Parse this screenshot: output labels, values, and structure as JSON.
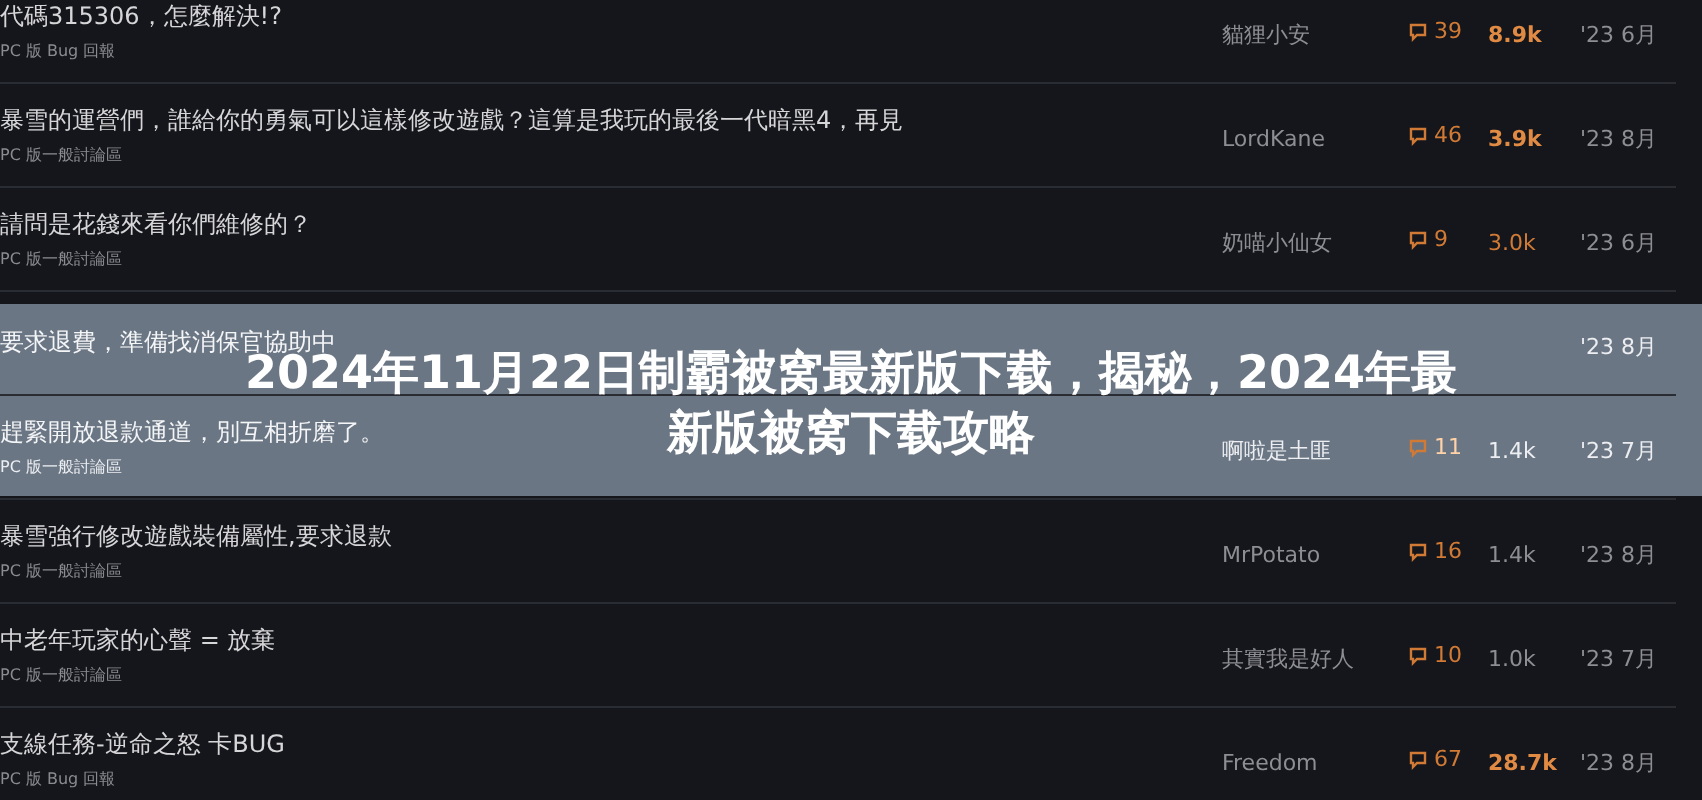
{
  "topics": [
    {
      "title": "代碼315306，怎麼解決!?",
      "forum": "PC 版 Bug 回報",
      "author": "貓狸小安",
      "replies": "39",
      "views": "8.9k",
      "highlighted": true,
      "bold": true,
      "date": "'23 6月"
    },
    {
      "title": "暴雪的運營們，誰給你的勇氣可以這樣修改遊戲？這算是我玩的最後一代暗黑4，再見",
      "forum": "PC 版一般討論區",
      "author": "LordKane",
      "replies": "46",
      "views": "3.9k",
      "highlighted": true,
      "bold": true,
      "date": "'23 8月"
    },
    {
      "title": "請問是花錢來看你們維修的？",
      "forum": "PC 版一般討論區",
      "author": "奶喵小仙女",
      "replies": "9",
      "views": "3.0k",
      "highlighted": true,
      "bold": false,
      "date": "'23 6月"
    },
    {
      "title": "要求退費，準備找消保官協助中",
      "date": "'23 8月"
    },
    {
      "title": "趕緊開放退款通道，別互相折磨了。",
      "forum": "PC 版一般討論區",
      "author": "啊啦是土匪",
      "replies": "11",
      "views": "1.4k",
      "highlighted": false,
      "bold": false,
      "date": "'23 7月"
    },
    {
      "title": "暴雪強行修改遊戲裝備屬性,要求退款",
      "forum": "PC 版一般討論區",
      "author": "MrPotato",
      "replies": "16",
      "views": "1.4k",
      "highlighted": false,
      "bold": false,
      "date": "'23 8月"
    },
    {
      "title": "中老年玩家的心聲 = 放棄",
      "forum": "PC 版一般討論區",
      "author": "其實我是好人",
      "replies": "10",
      "views": "1.0k",
      "highlighted": false,
      "bold": false,
      "date": "'23 7月"
    },
    {
      "title": "支線任務-逆命之怒 卡BUG",
      "forum": "PC 版 Bug 回報",
      "author": "Freedom",
      "replies": "67",
      "views": "28.7k",
      "highlighted": true,
      "bold": true,
      "date": "'23 8月"
    }
  ],
  "banner": {
    "lines": [
      "2024年11月22日制霸被窝最新版下载，揭秘，2024年最",
      "新版被窝下载攻略"
    ]
  }
}
